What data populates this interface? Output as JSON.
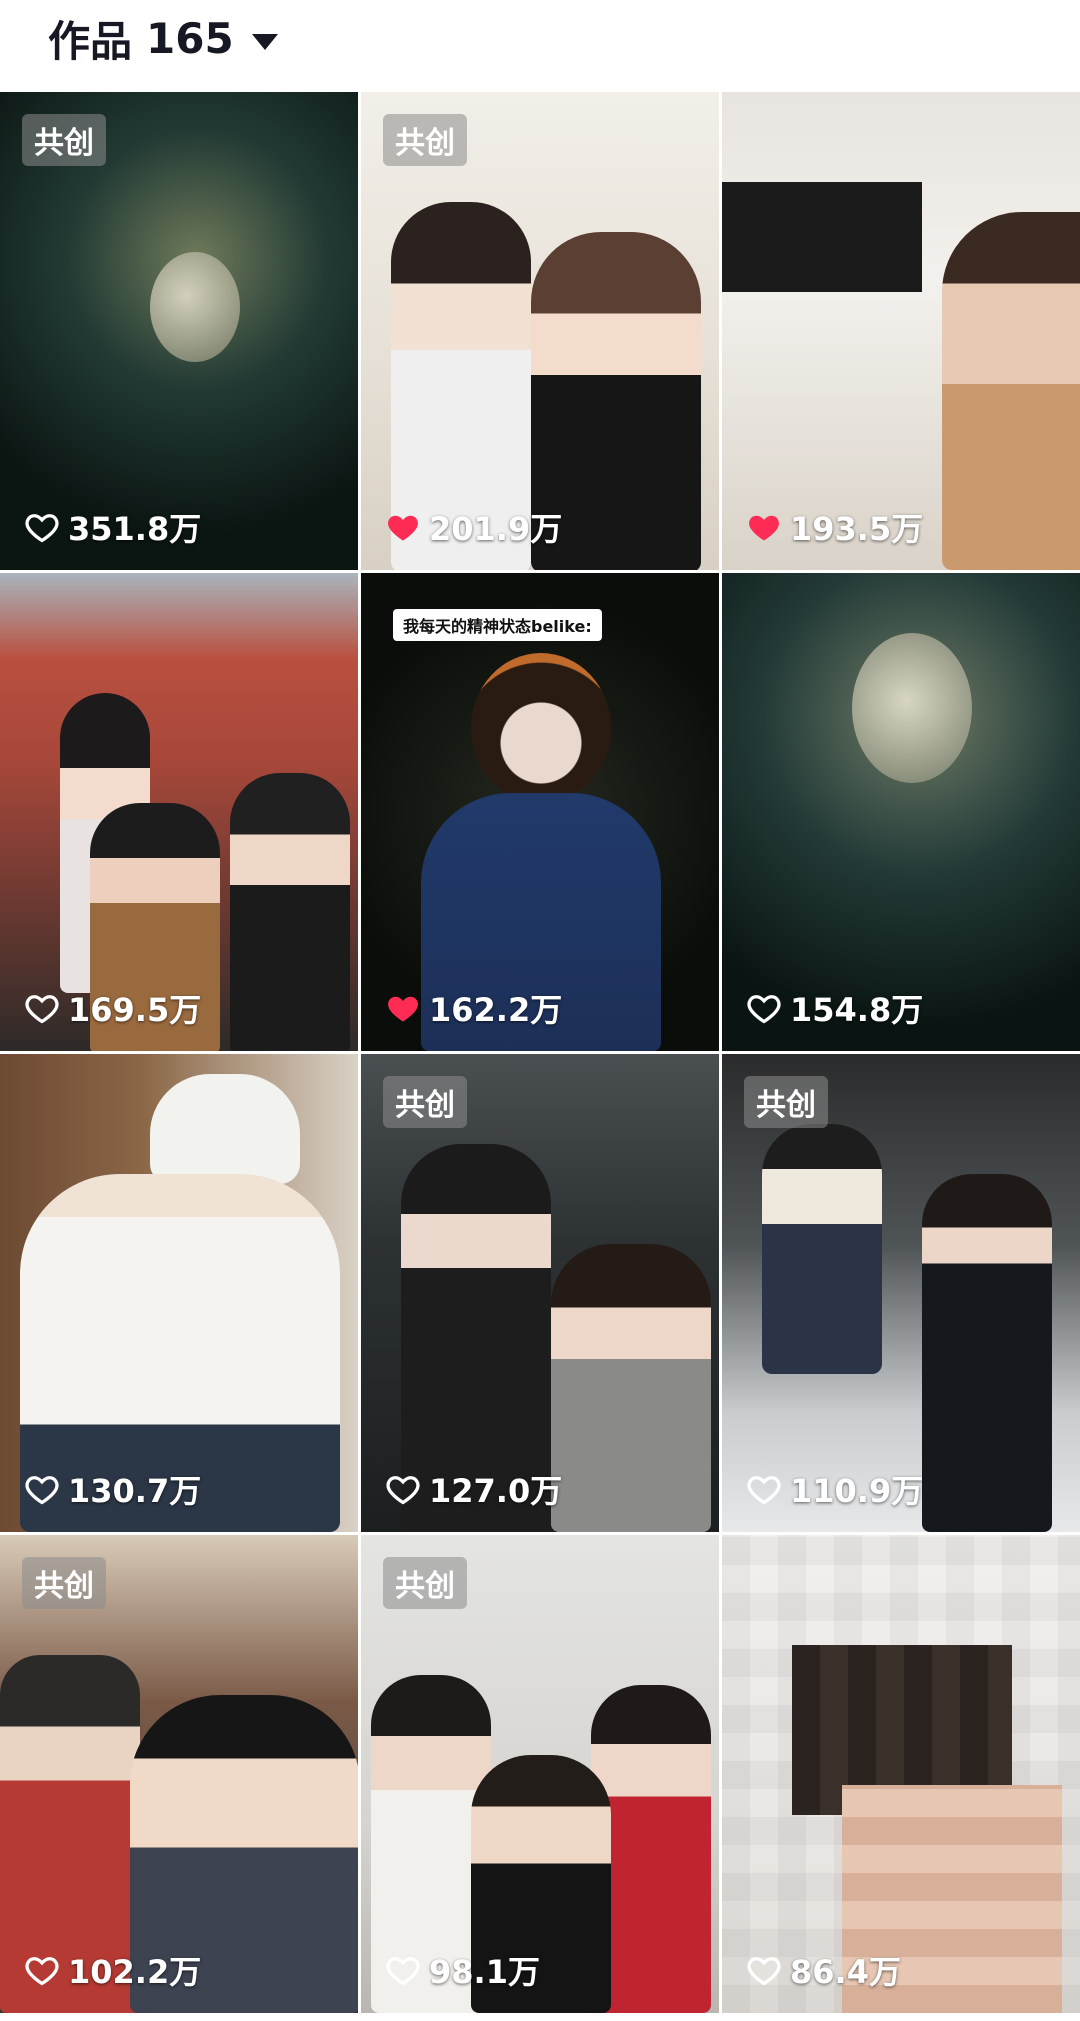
{
  "header": {
    "title": "作品",
    "count": "165"
  },
  "colors": {
    "heart_red": "#fe2c55",
    "badge_bg": "#8c8c8c"
  },
  "tiles": [
    {
      "likes": "351.8万",
      "badge": "共创",
      "liked": false
    },
    {
      "likes": "201.9万",
      "badge": "共创",
      "liked": true
    },
    {
      "likes": "193.5万",
      "badge": "",
      "liked": true
    },
    {
      "likes": "169.5万",
      "badge": "",
      "liked": false
    },
    {
      "likes": "162.2万",
      "badge": "",
      "liked": true,
      "overlay_text": "我每天的精神状态belike:"
    },
    {
      "likes": "154.8万",
      "badge": "",
      "liked": false
    },
    {
      "likes": "130.7万",
      "badge": "",
      "liked": false
    },
    {
      "likes": "127.0万",
      "badge": "共创",
      "liked": false
    },
    {
      "likes": "110.9万",
      "badge": "共创",
      "liked": false
    },
    {
      "likes": "102.2万",
      "badge": "共创",
      "liked": false
    },
    {
      "likes": "98.1万",
      "badge": "共创",
      "liked": false
    },
    {
      "likes": "86.4万",
      "badge": "",
      "liked": false
    }
  ]
}
